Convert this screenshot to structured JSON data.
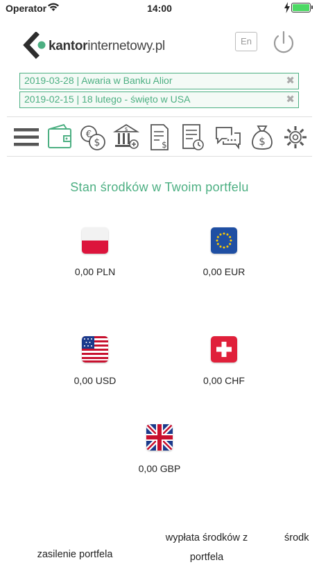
{
  "status_bar": {
    "carrier": "Operator",
    "time": "14:00"
  },
  "header": {
    "logo_bold": "kantor",
    "logo_light": "internetowy.pl",
    "lang_label": "En"
  },
  "news": [
    {
      "text": "2019-03-28 | Awaria w Banku Alior",
      "close": "✖"
    },
    {
      "text": "2019-02-15 | 18 lutego - święto w USA",
      "close": "✖"
    }
  ],
  "toolbar": {
    "items": [
      "menu-icon",
      "wallet-icon",
      "exchange-icon",
      "bank-icon",
      "invoice-icon",
      "history-icon",
      "chat-icon",
      "money-bag-icon",
      "settings-icon"
    ],
    "accent": "#4caf82",
    "icon_color": "#555555"
  },
  "main": {
    "title": "Stan środków w Twoim portfelu"
  },
  "balances": [
    {
      "currency": "PLN",
      "value": "0,00 PLN"
    },
    {
      "currency": "EUR",
      "value": "0,00 EUR"
    },
    {
      "currency": "USD",
      "value": "0,00 USD"
    },
    {
      "currency": "CHF",
      "value": "0,00 CHF"
    },
    {
      "currency": "GBP",
      "value": "0,00 GBP"
    }
  ],
  "bottom_tabs": {
    "deposit": "zasilenie portfela",
    "withdraw_line1": "wypłata środków z",
    "withdraw_line2": "portfela",
    "more": "środk"
  }
}
